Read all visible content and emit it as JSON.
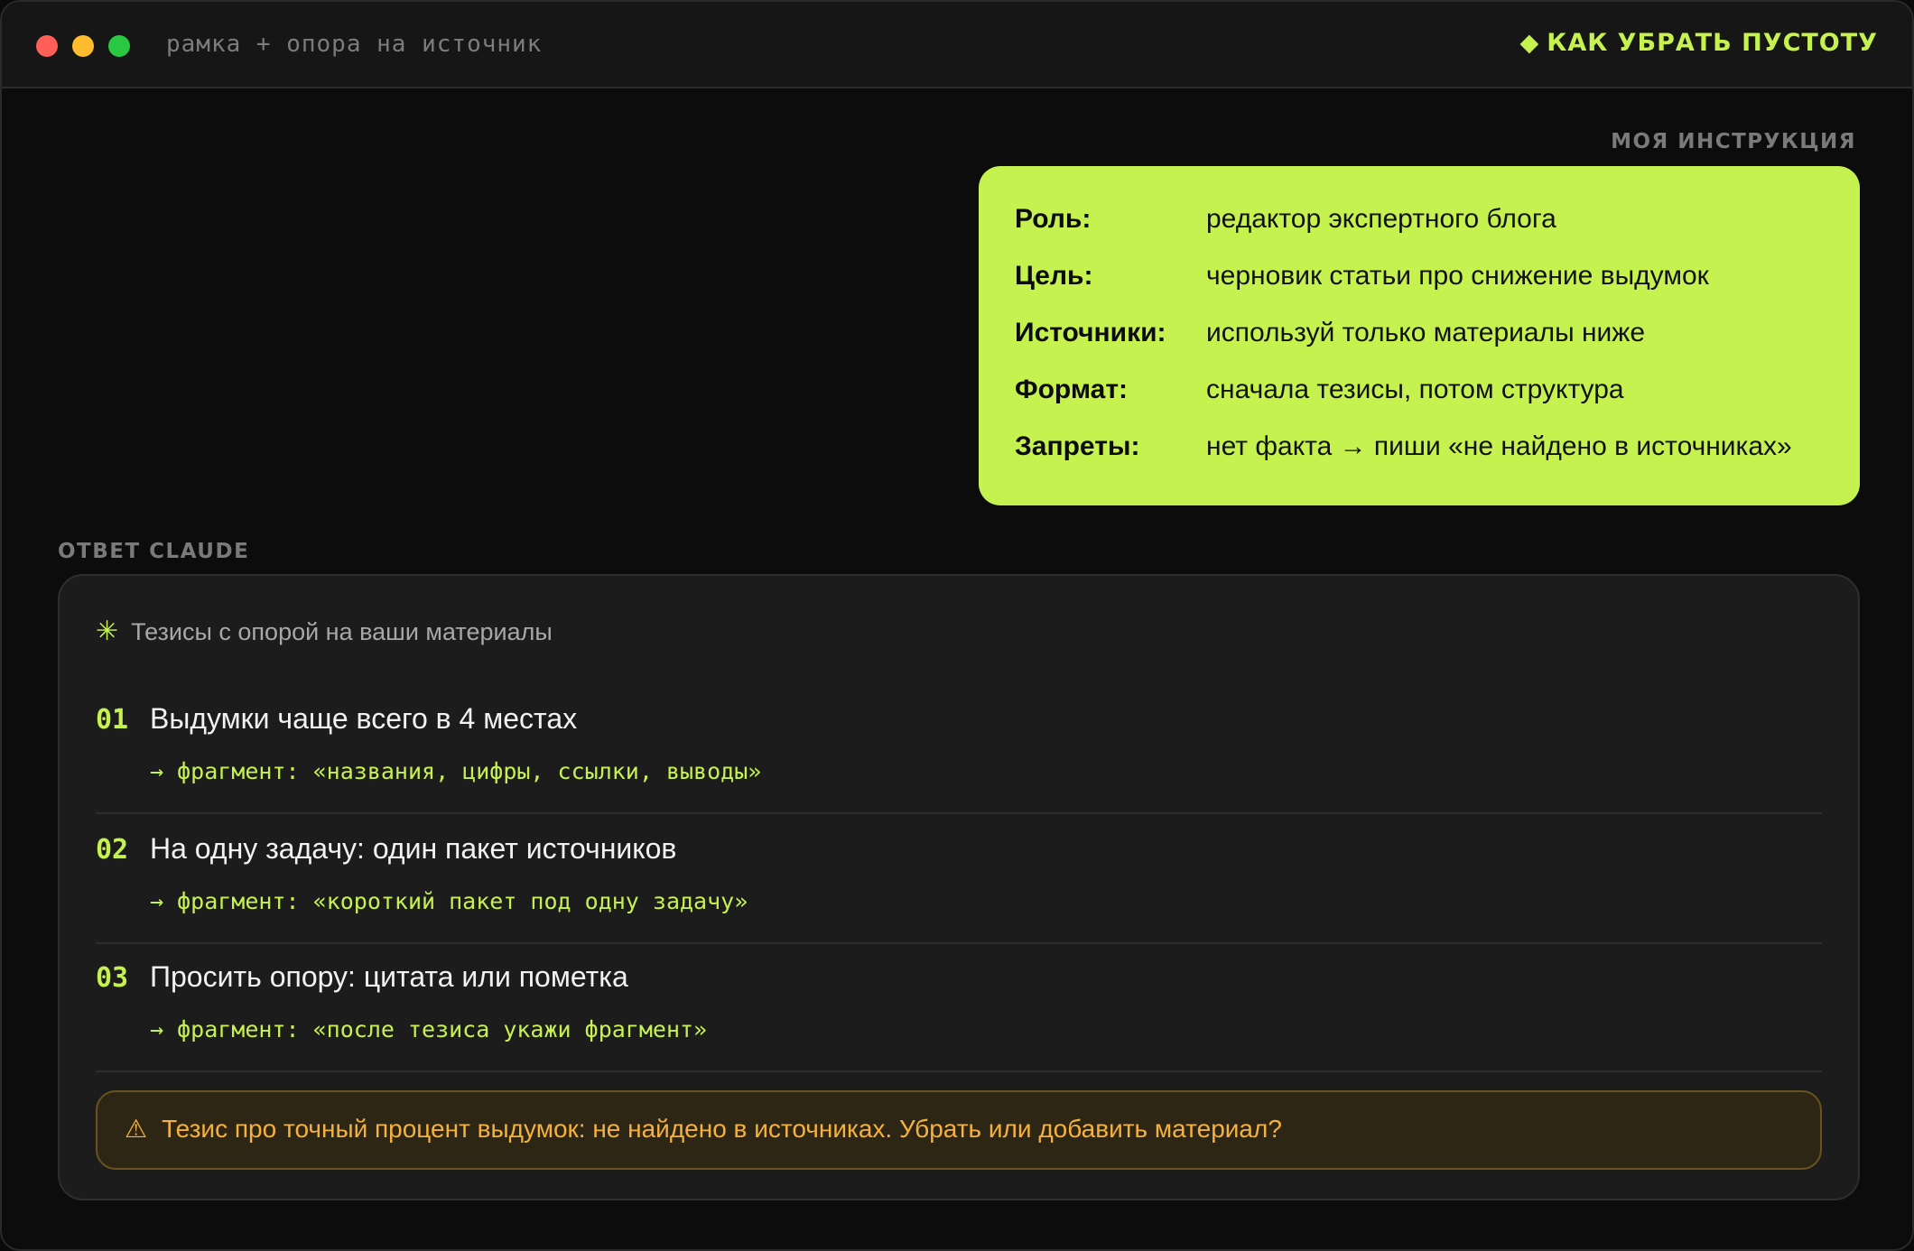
{
  "window": {
    "title": "рамка + опора на источник",
    "brand": "КАК УБРАТЬ ПУСТОТУ",
    "brand_icon": "diamond-icon"
  },
  "instruction": {
    "label": "МОЯ ИНСТРУКЦИЯ",
    "rows": [
      {
        "key": "Роль:",
        "value": "редактор экспертного блога"
      },
      {
        "key": "Цель:",
        "value": "черновик статьи про снижение выдумок"
      },
      {
        "key": "Источники:",
        "value": "используй только материалы ниже"
      },
      {
        "key": "Формат:",
        "value": "сначала тезисы, потом структура"
      },
      {
        "key": "Запреты:",
        "value": "нет факта → пиши «не найдено в источниках»"
      }
    ]
  },
  "answer": {
    "label": "ОТВЕТ CLAUDE",
    "header_icon": "asterisk-icon",
    "header": "Тезисы с опорой на ваши материалы",
    "theses": [
      {
        "num": "01",
        "title": "Выдумки чаще всего в 4 местах",
        "fragment": "→ фрагмент: «названия, цифры, ссылки, выводы»"
      },
      {
        "num": "02",
        "title": "На одну задачу: один пакет источников",
        "fragment": "→ фрагмент: «короткий пакет под одну задачу»"
      },
      {
        "num": "03",
        "title": "Просить опору: цитата или пометка",
        "fragment": "→ фрагмент: «после тезиса укажи фрагмент»"
      }
    ],
    "warning_icon": "warning-icon",
    "warning": "Тезис про точный процент выдумок: не найдено в источниках. Убрать или добавить материал?"
  },
  "colors": {
    "accent": "#c6f250",
    "background": "#0c0c0c",
    "card": "#1c1c1c",
    "warning_text": "#f5b13d",
    "warning_bg": "#2e2615"
  }
}
